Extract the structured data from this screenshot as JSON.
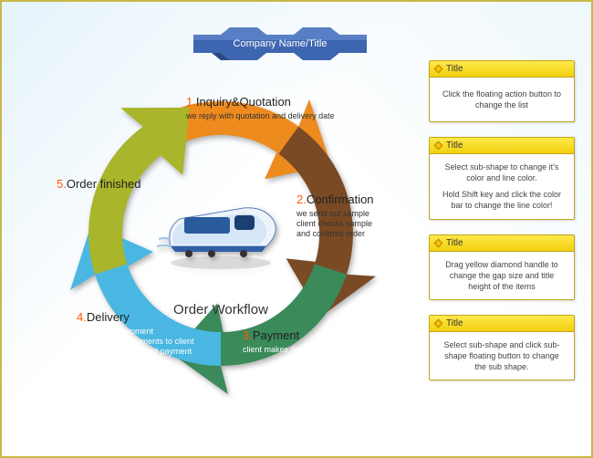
{
  "banner": {
    "label": "Company Name/Title"
  },
  "center": {
    "label": "Order Workflow"
  },
  "steps": [
    {
      "num": "1.",
      "title": "Inquiry&Quotation",
      "desc": "we reply with quotation and delivery date"
    },
    {
      "num": "2.",
      "title": "Confirmation",
      "desc": "we send out sample\nclient checks sample\nand confirms order"
    },
    {
      "num": "3.",
      "title": "Payment",
      "desc": "client makes deposit"
    },
    {
      "num": "4.",
      "title": "Delivery",
      "desc": "we arrange shipment\nwe send out documents to client\nclient makes balanced payment"
    },
    {
      "num": "5.",
      "title": "Order finished",
      "desc": ""
    }
  ],
  "cards": [
    {
      "title": "Title",
      "body": [
        "Click the floating action button to change the list"
      ]
    },
    {
      "title": "Title",
      "body": [
        "Select sub-shape to change it's color and line color.",
        "Hold Shift key and click the color bar to change the line color!"
      ]
    },
    {
      "title": "Title",
      "body": [
        "Drag yellow diamond handle to change the gap size and title height of the items"
      ]
    },
    {
      "title": "Title",
      "body": [
        "Select sub-shape and click sub-shape floating button to change the sub shape."
      ]
    }
  ],
  "colors": {
    "seg1": "#ed8b1f",
    "seg2": "#7a4a24",
    "seg3": "#3a8a5a",
    "seg4": "#49b7e2",
    "seg5": "#a9b52a"
  },
  "watermark": ""
}
